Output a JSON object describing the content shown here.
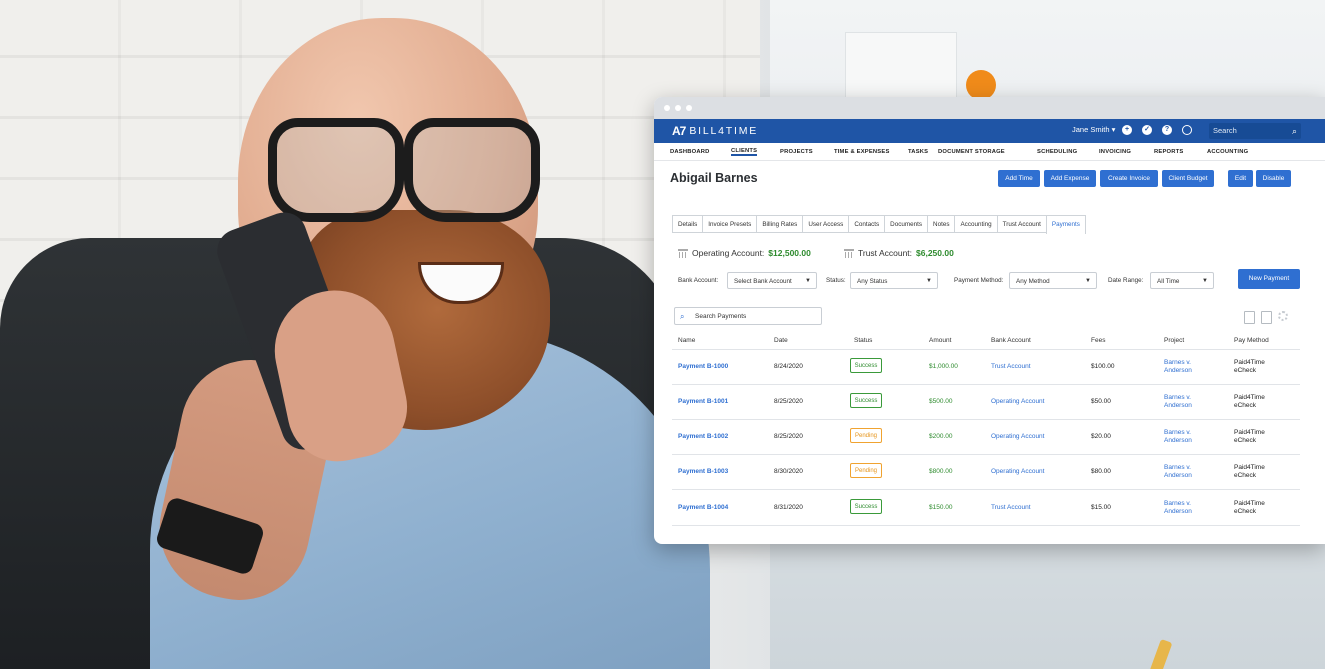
{
  "app": {
    "brand": "BILL4TIME",
    "logo_mark": "A7",
    "user": "Jane Smith ▾",
    "search_placeholder": "Search",
    "top_icons": [
      "plus-icon",
      "check-icon",
      "help-icon",
      "clock-icon"
    ]
  },
  "nav": [
    "DASHBOARD",
    "CLIENTS",
    "PROJECTS",
    "TIME & EXPENSES",
    "TASKS",
    "DOCUMENT STORAGE",
    "SCHEDULING",
    "INVOICING",
    "REPORTS",
    "ACCOUNTING"
  ],
  "client": {
    "name": "Abigail Barnes",
    "actions": [
      "Add Time",
      "Add Expense",
      "Create Invoice",
      "Client Budget",
      "Edit",
      "Disable"
    ]
  },
  "tabs": [
    "Details",
    "Invoice Presets",
    "Billing Rates",
    "User Access",
    "Contacts",
    "Documents",
    "Notes",
    "Accounting",
    "Trust Account",
    "Payments"
  ],
  "active_tab": "Payments",
  "accounts": {
    "operating_label": "Operating Account:",
    "operating_value": "$12,500.00",
    "trust_label": "Trust Account:",
    "trust_value": "$6,250.00"
  },
  "filters": {
    "bank_label": "Bank Account:",
    "bank_value": "Select Bank Account",
    "status_label": "Status:",
    "status_value": "Any Status",
    "method_label": "Payment Method:",
    "method_value": "Any Method",
    "range_label": "Date Range:",
    "range_value": "All Time",
    "new_payment": "New Payment"
  },
  "payments_search": "Search Payments",
  "columns": [
    "Name",
    "Date",
    "Status",
    "Amount",
    "Bank Account",
    "Fees",
    "Project",
    "Pay Method"
  ],
  "rows": [
    {
      "name": "Payment B-1000",
      "date": "8/24/2020",
      "status": "Success",
      "amount": "$1,000.00",
      "bank": "Trust Account",
      "fees": "$100.00",
      "project1": "Barnes v.",
      "project2": "Anderson",
      "method1": "Paid4Time",
      "method2": "eCheck"
    },
    {
      "name": "Payment B-1001",
      "date": "8/25/2020",
      "status": "Success",
      "amount": "$500.00",
      "bank": "Operating Account",
      "fees": "$50.00",
      "project1": "Barnes v.",
      "project2": "Anderson",
      "method1": "Paid4Time",
      "method2": "eCheck"
    },
    {
      "name": "Payment B-1002",
      "date": "8/25/2020",
      "status": "Pending",
      "amount": "$200.00",
      "bank": "Operating Account",
      "fees": "$20.00",
      "project1": "Barnes v.",
      "project2": "Anderson",
      "method1": "Paid4Time",
      "method2": "eCheck"
    },
    {
      "name": "Payment B-1003",
      "date": "8/30/2020",
      "status": "Pending",
      "amount": "$800.00",
      "bank": "Operating Account",
      "fees": "$80.00",
      "project1": "Barnes v.",
      "project2": "Anderson",
      "method1": "Paid4Time",
      "method2": "eCheck"
    },
    {
      "name": "Payment B-1004",
      "date": "8/31/2020",
      "status": "Success",
      "amount": "$150.00",
      "bank": "Trust Account",
      "fees": "$15.00",
      "project1": "Barnes v.",
      "project2": "Anderson",
      "method1": "Paid4Time",
      "method2": "eCheck"
    }
  ],
  "colors": {
    "brand_blue": "#1f55a6",
    "button_blue": "#2f6fd1",
    "success_green": "#2e8b2e",
    "pending_orange": "#e69419"
  }
}
